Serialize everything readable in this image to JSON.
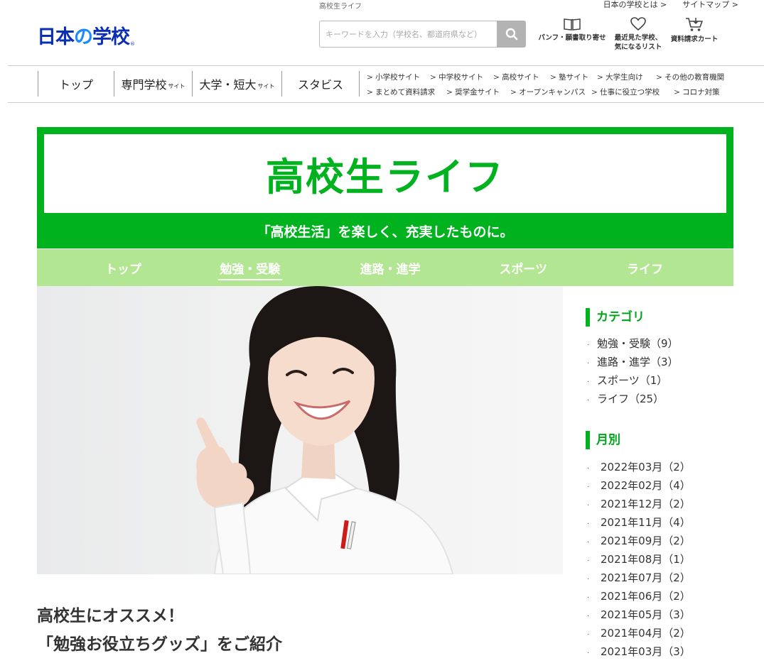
{
  "header": {
    "breadcrumb": "高校生ライフ",
    "top_links": [
      "日本の学校とは >",
      "サイトマップ >"
    ],
    "logo": {
      "main": "日本",
      "no": "の",
      "rest": "学校",
      "reg": "®"
    },
    "search_placeholder": "キーワードを入力（学校名、都道府県など）",
    "icons": [
      {
        "name": "book-icon",
        "label1": "パンフ・願書取り寄せ",
        "label2": ""
      },
      {
        "name": "heart-icon",
        "label1": "最近見た学校、",
        "label2": "気になるリスト"
      },
      {
        "name": "cart-icon",
        "label1": "資料請求カート",
        "label2": ""
      }
    ]
  },
  "gnav": {
    "items": [
      {
        "label": "トップ",
        "small": ""
      },
      {
        "label": "専門学校",
        "small": "サイト"
      },
      {
        "label": "大学・短大",
        "small": "サイト"
      },
      {
        "label": "スタビス",
        "small": ""
      }
    ],
    "sublinks_row1": [
      "> 小学校サイト",
      "> 中学校サイト",
      "> 高校サイト",
      "> 塾サイト",
      "> 大学生向け",
      "> その他の教育機関"
    ],
    "sublinks_row2": [
      "> まとめて資料請求",
      "> 奨学金サイト",
      "> オープンキャンパス",
      "> 仕事に役立つ学校",
      "> コロナ対策"
    ]
  },
  "hero": {
    "title": "高校生ライフ",
    "subtitle": "「高校生活」を楽しく、充実したものに。"
  },
  "subnav": {
    "items": [
      "トップ",
      "勉強・受験",
      "進路・進学",
      "スポーツ",
      "ライフ"
    ],
    "active_index": 1
  },
  "article": {
    "title_line1": "高校生にオススメ！",
    "title_line2": "「勉強お役立ちグッズ」をご紹介"
  },
  "sidebar": {
    "category_heading": "カテゴリ",
    "categories": [
      "勉強・受験（9）",
      "進路・進学（3）",
      "スポーツ（1）",
      "ライフ（25）"
    ],
    "monthly_heading": "月別",
    "months": [
      "2022年03月（2）",
      "2022年02月（4）",
      "2021年12月（2）",
      "2021年11月（4）",
      "2021年09月（2）",
      "2021年08月（1）",
      "2021年07月（2）",
      "2021年06月（2）",
      "2021年05月（3）",
      "2021年04月（2）",
      "2021年03月（3）"
    ]
  },
  "colors": {
    "brand_green": "#00b31e",
    "light_green": "#b3e693",
    "logo_blue": "#0a2fb4"
  }
}
